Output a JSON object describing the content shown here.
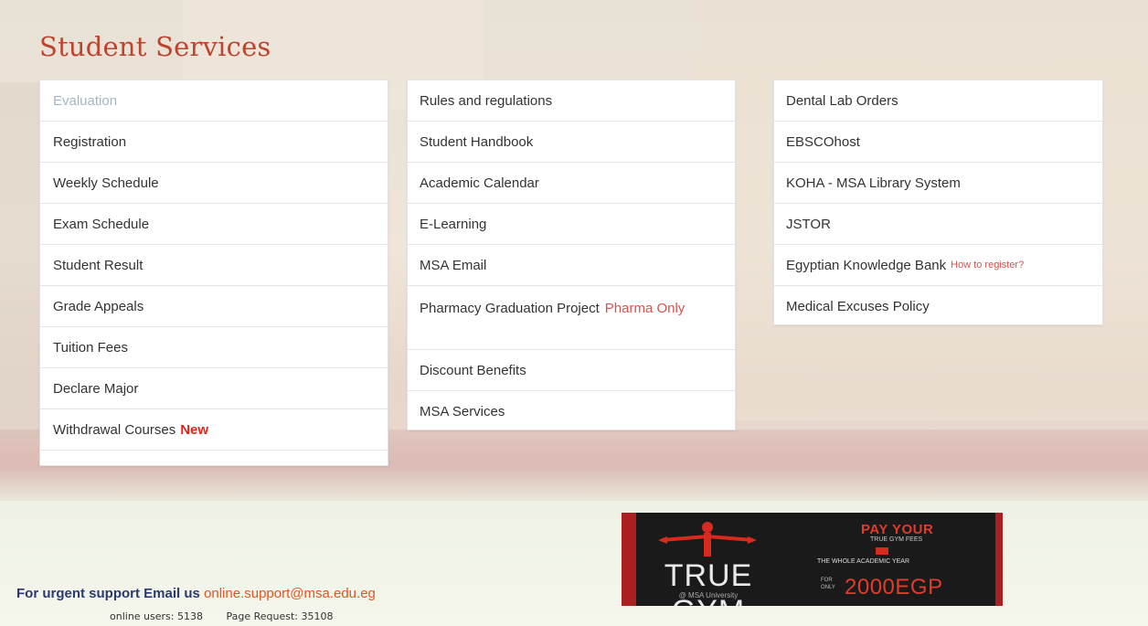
{
  "page": {
    "title": "Student Services"
  },
  "columns": {
    "col1": [
      {
        "label": "Evaluation",
        "muted": true
      },
      {
        "label": "Registration"
      },
      {
        "label": "Weekly Schedule"
      },
      {
        "label": "Exam Schedule"
      },
      {
        "label": "Student Result"
      },
      {
        "label": "Grade Appeals"
      },
      {
        "label": "Tuition Fees"
      },
      {
        "label": "Declare Major"
      },
      {
        "label": "Withdrawal Courses",
        "tag": "New"
      }
    ],
    "col2": [
      {
        "label": "Rules and regulations"
      },
      {
        "label": "Student Handbook"
      },
      {
        "label": "Academic Calendar"
      },
      {
        "label": "E-Learning"
      },
      {
        "label": "MSA Email"
      },
      {
        "label": "Pharmacy Graduation Project",
        "tag": "Pharma Only"
      },
      {
        "label": "Discount Benefits"
      },
      {
        "label": "MSA Services"
      }
    ],
    "col3": [
      {
        "label": "Dental Lab Orders"
      },
      {
        "label": "EBSCOhost"
      },
      {
        "label": "KOHA - MSA Library System"
      },
      {
        "label": "JSTOR"
      },
      {
        "label": "Egyptian Knowledge Bank",
        "tag": "How to register?"
      },
      {
        "label": "Medical Excuses Policy"
      }
    ]
  },
  "footer": {
    "support_text": "For urgent support Email us",
    "support_email": "online.support@msa.edu.eg",
    "online_users": "online users: 5138",
    "page_request": "Page Request: 35108"
  },
  "banner": {
    "gym_name": "TRUE GYM",
    "gym_sub": "@ MSA University",
    "pay_your": "PAY YOUR",
    "fees_line": "TRUE GYM FEES",
    "year_line": "THE WHOLE ACADEMIC YEAR",
    "for_only": "FOR ONLY",
    "price": "2000EGP"
  },
  "colors": {
    "title": "#c0432e",
    "tag_new": "#e1251b",
    "email_link": "#e3541f",
    "support_text": "#2a3a6e"
  }
}
